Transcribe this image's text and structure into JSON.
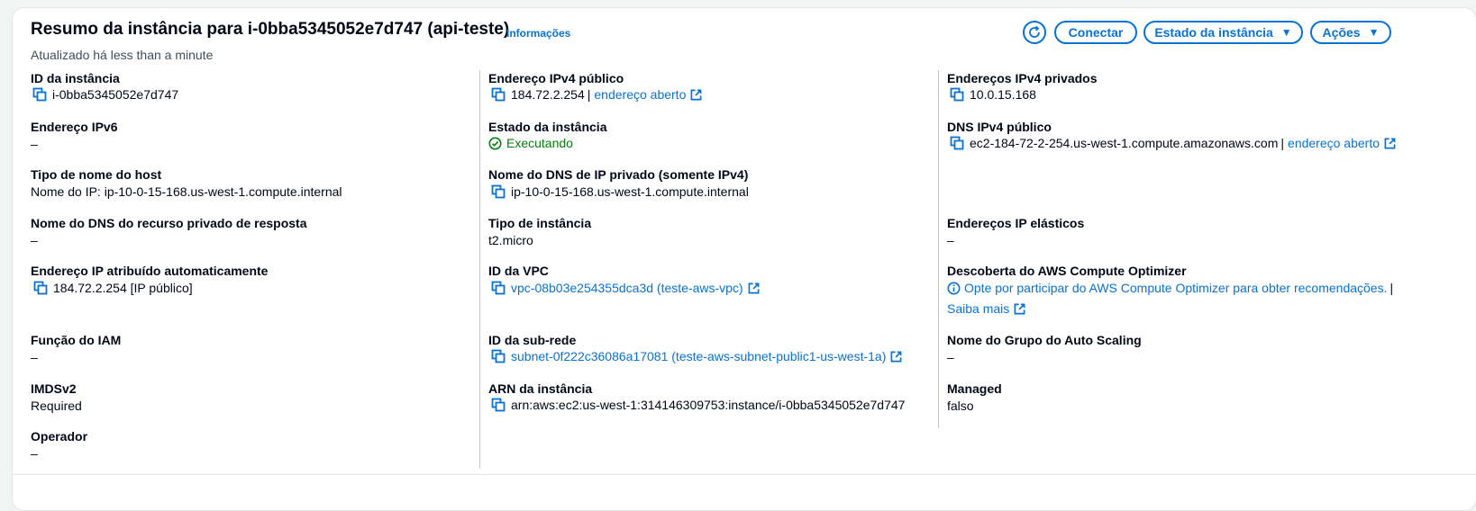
{
  "header": {
    "title": "Resumo da instância para i-0bba5345052e7d747 (api-teste)",
    "info_link": "Informações",
    "subtitle": "Atualizado há less than a minute",
    "buttons": {
      "connect": "Conectar",
      "instance_state": "Estado da instância",
      "actions": "Ações"
    }
  },
  "col1": {
    "instance_id": {
      "label": "ID da instância",
      "value": "i-0bba5345052e7d747"
    },
    "ipv6": {
      "label": "Endereço IPv6",
      "value": "–"
    },
    "hostname_type": {
      "label": "Tipo de nome do host",
      "value": "Nome do IP: ip-10-0-15-168.us-west-1.compute.internal"
    },
    "private_dns_response": {
      "label": "Nome do DNS do recurso privado de resposta",
      "value": "–"
    },
    "auto_ip": {
      "label": "Endereço IP atribuído automaticamente",
      "value": "184.72.2.254 [IP público]"
    },
    "iam_role": {
      "label": "Função do IAM",
      "value": "–"
    },
    "imdsv2": {
      "label": "IMDSv2",
      "value": "Required"
    },
    "operator": {
      "label": "Operador",
      "value": "–"
    }
  },
  "col2": {
    "public_ipv4": {
      "label": "Endereço IPv4 público",
      "value": "184.72.2.254",
      "link": "endereço aberto"
    },
    "instance_state": {
      "label": "Estado da instância",
      "value": "Executando"
    },
    "private_dns": {
      "label": "Nome do DNS de IP privado (somente IPv4)",
      "value": "ip-10-0-15-168.us-west-1.compute.internal"
    },
    "instance_type": {
      "label": "Tipo de instância",
      "value": "t2.micro"
    },
    "vpc_id": {
      "label": "ID da VPC",
      "value": "vpc-08b03e254355dca3d (teste-aws-vpc)"
    },
    "subnet_id": {
      "label": "ID da sub-rede",
      "value": "subnet-0f222c36086a17081 (teste-aws-subnet-public1-us-west-1a)"
    },
    "arn": {
      "label": "ARN da instância",
      "value": "arn:aws:ec2:us-west-1:314146309753:instance/i-0bba5345052e7d747"
    }
  },
  "col3": {
    "private_ipv4": {
      "label": "Endereços IPv4 privados",
      "value": "10.0.15.168"
    },
    "public_dns": {
      "label": "DNS IPv4 público",
      "value": "ec2-184-72-2-254.us-west-1.compute.amazonaws.com",
      "link": "endereço aberto"
    },
    "elastic_ips": {
      "label": "Endereços IP elásticos",
      "value": "–"
    },
    "compute_optimizer": {
      "label": "Descoberta do AWS Compute Optimizer",
      "value": "Opte por participar do AWS Compute Optimizer para obter recomendações.",
      "learn_more": "Saiba mais"
    },
    "asg": {
      "label": "Nome do Grupo do Auto Scaling",
      "value": "–"
    },
    "managed": {
      "label": "Managed",
      "value": "falso"
    }
  },
  "colors": {
    "link": "#0972d3",
    "success": "#037f0c",
    "text": "#000716",
    "secondary_text": "#414d5c"
  },
  "icons": [
    "refresh-icon",
    "copy-icon",
    "external-link-icon",
    "success-check-icon",
    "info-icon",
    "caret-down-icon"
  ]
}
